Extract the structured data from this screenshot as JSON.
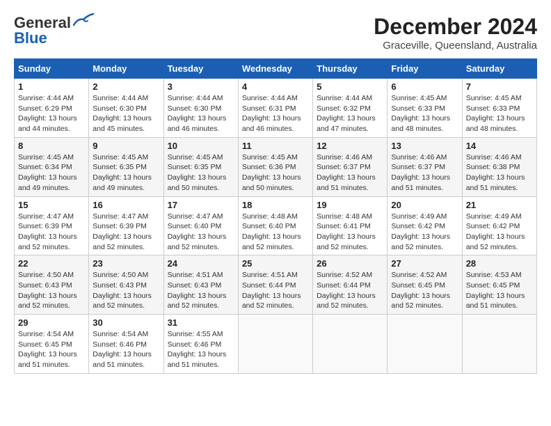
{
  "header": {
    "logo_line1": "General",
    "logo_line2": "Blue",
    "title": "December 2024",
    "subtitle": "Graceville, Queensland, Australia"
  },
  "calendar": {
    "columns": [
      "Sunday",
      "Monday",
      "Tuesday",
      "Wednesday",
      "Thursday",
      "Friday",
      "Saturday"
    ],
    "weeks": [
      [
        {
          "day": "",
          "info": ""
        },
        {
          "day": "2",
          "info": "Sunrise: 4:44 AM\nSunset: 6:30 PM\nDaylight: 13 hours\nand 45 minutes."
        },
        {
          "day": "3",
          "info": "Sunrise: 4:44 AM\nSunset: 6:30 PM\nDaylight: 13 hours\nand 46 minutes."
        },
        {
          "day": "4",
          "info": "Sunrise: 4:44 AM\nSunset: 6:31 PM\nDaylight: 13 hours\nand 46 minutes."
        },
        {
          "day": "5",
          "info": "Sunrise: 4:44 AM\nSunset: 6:32 PM\nDaylight: 13 hours\nand 47 minutes."
        },
        {
          "day": "6",
          "info": "Sunrise: 4:45 AM\nSunset: 6:33 PM\nDaylight: 13 hours\nand 48 minutes."
        },
        {
          "day": "7",
          "info": "Sunrise: 4:45 AM\nSunset: 6:33 PM\nDaylight: 13 hours\nand 48 minutes."
        }
      ],
      [
        {
          "day": "1",
          "info": "Sunrise: 4:44 AM\nSunset: 6:29 PM\nDaylight: 13 hours\nand 44 minutes."
        },
        {
          "day": "",
          "info": ""
        },
        {
          "day": "",
          "info": ""
        },
        {
          "day": "",
          "info": ""
        },
        {
          "day": "",
          "info": ""
        },
        {
          "day": "",
          "info": ""
        },
        {
          "day": "",
          "info": ""
        }
      ],
      [
        {
          "day": "8",
          "info": "Sunrise: 4:45 AM\nSunset: 6:34 PM\nDaylight: 13 hours\nand 49 minutes."
        },
        {
          "day": "9",
          "info": "Sunrise: 4:45 AM\nSunset: 6:35 PM\nDaylight: 13 hours\nand 49 minutes."
        },
        {
          "day": "10",
          "info": "Sunrise: 4:45 AM\nSunset: 6:35 PM\nDaylight: 13 hours\nand 50 minutes."
        },
        {
          "day": "11",
          "info": "Sunrise: 4:45 AM\nSunset: 6:36 PM\nDaylight: 13 hours\nand 50 minutes."
        },
        {
          "day": "12",
          "info": "Sunrise: 4:46 AM\nSunset: 6:37 PM\nDaylight: 13 hours\nand 51 minutes."
        },
        {
          "day": "13",
          "info": "Sunrise: 4:46 AM\nSunset: 6:37 PM\nDaylight: 13 hours\nand 51 minutes."
        },
        {
          "day": "14",
          "info": "Sunrise: 4:46 AM\nSunset: 6:38 PM\nDaylight: 13 hours\nand 51 minutes."
        }
      ],
      [
        {
          "day": "15",
          "info": "Sunrise: 4:47 AM\nSunset: 6:39 PM\nDaylight: 13 hours\nand 52 minutes."
        },
        {
          "day": "16",
          "info": "Sunrise: 4:47 AM\nSunset: 6:39 PM\nDaylight: 13 hours\nand 52 minutes."
        },
        {
          "day": "17",
          "info": "Sunrise: 4:47 AM\nSunset: 6:40 PM\nDaylight: 13 hours\nand 52 minutes."
        },
        {
          "day": "18",
          "info": "Sunrise: 4:48 AM\nSunset: 6:40 PM\nDaylight: 13 hours\nand 52 minutes."
        },
        {
          "day": "19",
          "info": "Sunrise: 4:48 AM\nSunset: 6:41 PM\nDaylight: 13 hours\nand 52 minutes."
        },
        {
          "day": "20",
          "info": "Sunrise: 4:49 AM\nSunset: 6:42 PM\nDaylight: 13 hours\nand 52 minutes."
        },
        {
          "day": "21",
          "info": "Sunrise: 4:49 AM\nSunset: 6:42 PM\nDaylight: 13 hours\nand 52 minutes."
        }
      ],
      [
        {
          "day": "22",
          "info": "Sunrise: 4:50 AM\nSunset: 6:43 PM\nDaylight: 13 hours\nand 52 minutes."
        },
        {
          "day": "23",
          "info": "Sunrise: 4:50 AM\nSunset: 6:43 PM\nDaylight: 13 hours\nand 52 minutes."
        },
        {
          "day": "24",
          "info": "Sunrise: 4:51 AM\nSunset: 6:43 PM\nDaylight: 13 hours\nand 52 minutes."
        },
        {
          "day": "25",
          "info": "Sunrise: 4:51 AM\nSunset: 6:44 PM\nDaylight: 13 hours\nand 52 minutes."
        },
        {
          "day": "26",
          "info": "Sunrise: 4:52 AM\nSunset: 6:44 PM\nDaylight: 13 hours\nand 52 minutes."
        },
        {
          "day": "27",
          "info": "Sunrise: 4:52 AM\nSunset: 6:45 PM\nDaylight: 13 hours\nand 52 minutes."
        },
        {
          "day": "28",
          "info": "Sunrise: 4:53 AM\nSunset: 6:45 PM\nDaylight: 13 hours\nand 51 minutes."
        }
      ],
      [
        {
          "day": "29",
          "info": "Sunrise: 4:54 AM\nSunset: 6:45 PM\nDaylight: 13 hours\nand 51 minutes."
        },
        {
          "day": "30",
          "info": "Sunrise: 4:54 AM\nSunset: 6:46 PM\nDaylight: 13 hours\nand 51 minutes."
        },
        {
          "day": "31",
          "info": "Sunrise: 4:55 AM\nSunset: 6:46 PM\nDaylight: 13 hours\nand 51 minutes."
        },
        {
          "day": "",
          "info": ""
        },
        {
          "day": "",
          "info": ""
        },
        {
          "day": "",
          "info": ""
        },
        {
          "day": "",
          "info": ""
        }
      ]
    ]
  }
}
